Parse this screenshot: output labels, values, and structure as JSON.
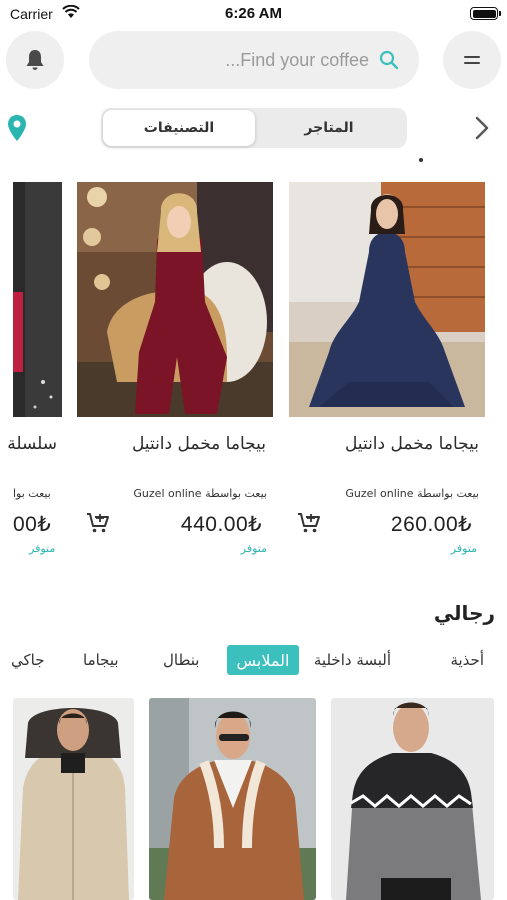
{
  "status_bar": {
    "carrier": "Carrier",
    "time": "6:26 AM"
  },
  "search": {
    "placeholder": "...Find your coffee"
  },
  "segmented": {
    "categories_label": "التصنيفات",
    "stores_label": "المتاجر"
  },
  "products": [
    {
      "title": "بيجاما مخمل دانتيل",
      "seller_label": "بيعت بواسطة",
      "seller": "Guzel online",
      "price": "260.00₺",
      "stock": "متوفر"
    },
    {
      "title": "بيجاما مخمل دانتيل",
      "seller_label": "بيعت بواسطة",
      "seller": "Guzel online",
      "price": "440.00₺",
      "stock": "متوفر"
    },
    {
      "title": "سلسلة",
      "seller_label": "بيعت بوا",
      "seller": "",
      "price": "00₺",
      "stock": "متوفر"
    }
  ],
  "section": {
    "title": "رجالي",
    "categories": [
      "أحذية",
      "ألبسة داخلية",
      "الملابس",
      "بنطال",
      "بيجاما",
      "جاكي"
    ],
    "active_category": "الملابس"
  },
  "colors": {
    "accent": "#3cc0bd",
    "background": "#ffffff",
    "chip_bg": "#efefef"
  }
}
